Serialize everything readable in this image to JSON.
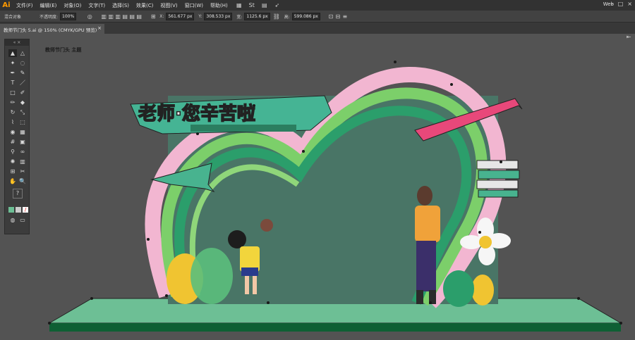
{
  "app": {
    "logo": "Ai"
  },
  "menu": [
    "文件(F)",
    "编辑(E)",
    "对象(O)",
    "文字(T)",
    "选择(S)",
    "效果(C)",
    "视图(V)",
    "窗口(W)",
    "帮助(H)"
  ],
  "workspace": "Web",
  "control": {
    "selection_label": "混合对象",
    "opacity_label": "不透明度:",
    "opacity_value": "100%",
    "x_label": "X:",
    "x_value": "561.677 px",
    "y_label": "Y:",
    "y_value": "308.533 px",
    "w_label": "宽:",
    "w_value": "1125.6 px",
    "h_label": "高:",
    "h_value": "599.086 px"
  },
  "document": {
    "tab_title": "教师节门头 5.ai @ 150% (CMYK/GPU 预览)",
    "close": "×"
  },
  "canvas": {
    "label": "教师节门头 主题"
  },
  "colors": {
    "accent": "#ff9a00",
    "stage_top": "#6dbf95",
    "stage_side": "#0e5f34",
    "pink": "#f2b6d1",
    "green_light": "#7ccf6a",
    "green_dark": "#2b9e6b",
    "teal": "#48b38f",
    "banner": "#e8487a"
  }
}
